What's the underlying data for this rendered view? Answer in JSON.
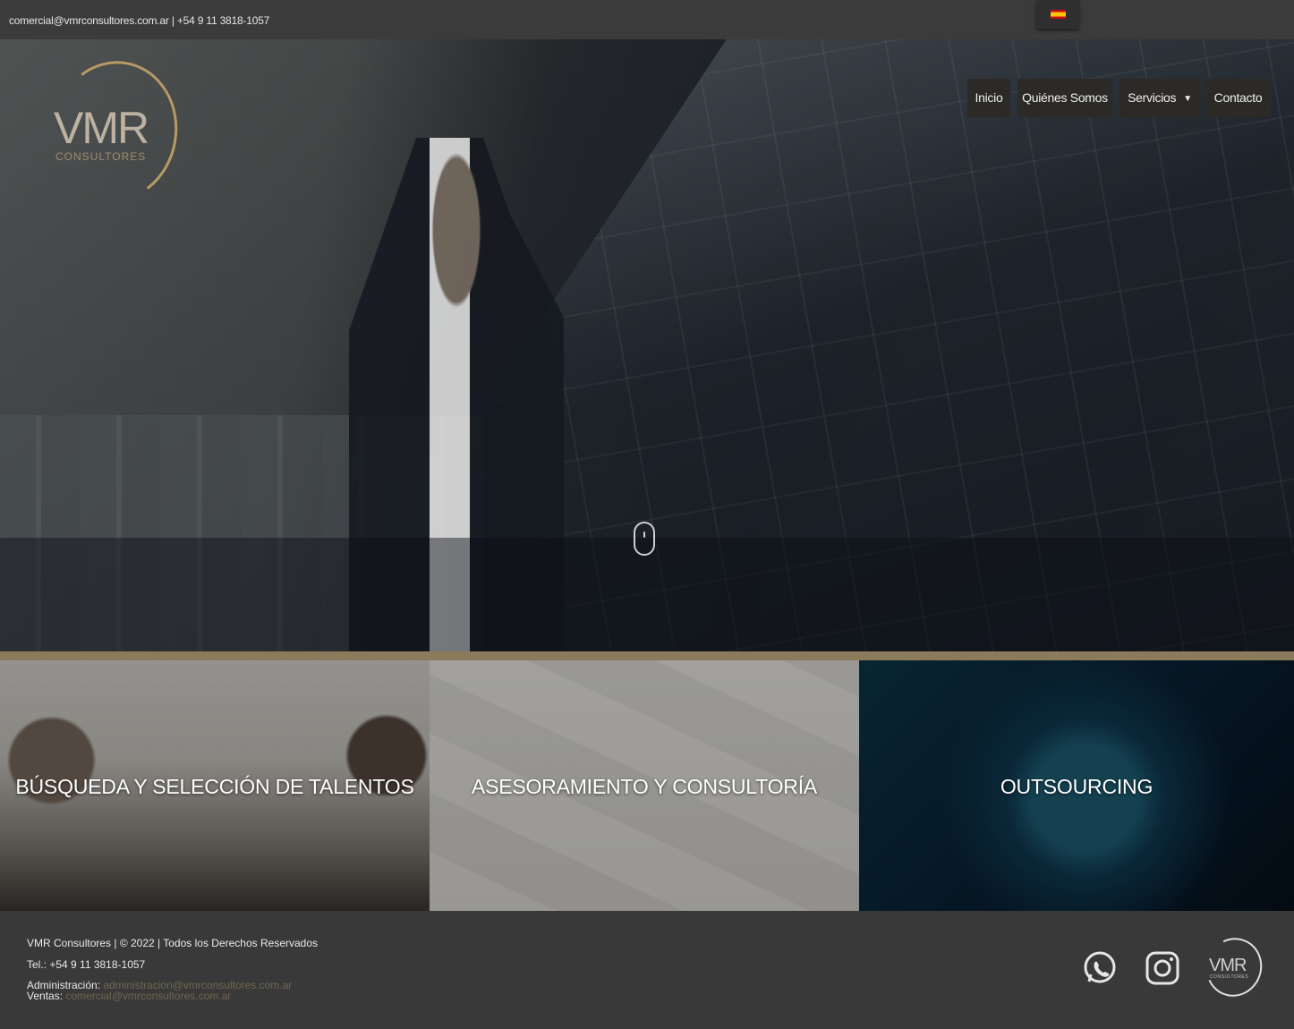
{
  "topbar": {
    "contact_text": "comercial@vmrconsultores.com.ar | +54 9 11 3818-1057",
    "language_flag": "es-flag"
  },
  "logo": {
    "main": "VMR",
    "sub": "CONSULTORES"
  },
  "nav": {
    "items": [
      "Inicio",
      "Quiénes Somos",
      "Servicios",
      "Contacto"
    ]
  },
  "services": [
    {
      "title": "BÚSQUEDA Y SELECCIÓN DE TALENTOS"
    },
    {
      "title": "ASESORAMIENTO Y CONSULTORÍA"
    },
    {
      "title": "OUTSOURCING"
    }
  ],
  "footer": {
    "copyright": "VMR Consultores | © 2022 | Todos los Derechos Reservados",
    "tel": "Tel.: +54 9 11 3818-1057",
    "admin_label": "Administración: ",
    "admin_email": "administracion@vmrconsultores.com.ar",
    "sales_label": "Ventas: ",
    "sales_email": "comercial@vmrconsultores.com.ar",
    "logo_main": "VMR",
    "logo_sub": "CONSULTORES"
  },
  "colors": {
    "gold": "#b89a66",
    "topbar_bg": "#3b3b3b",
    "footer_bg": "#393939"
  }
}
